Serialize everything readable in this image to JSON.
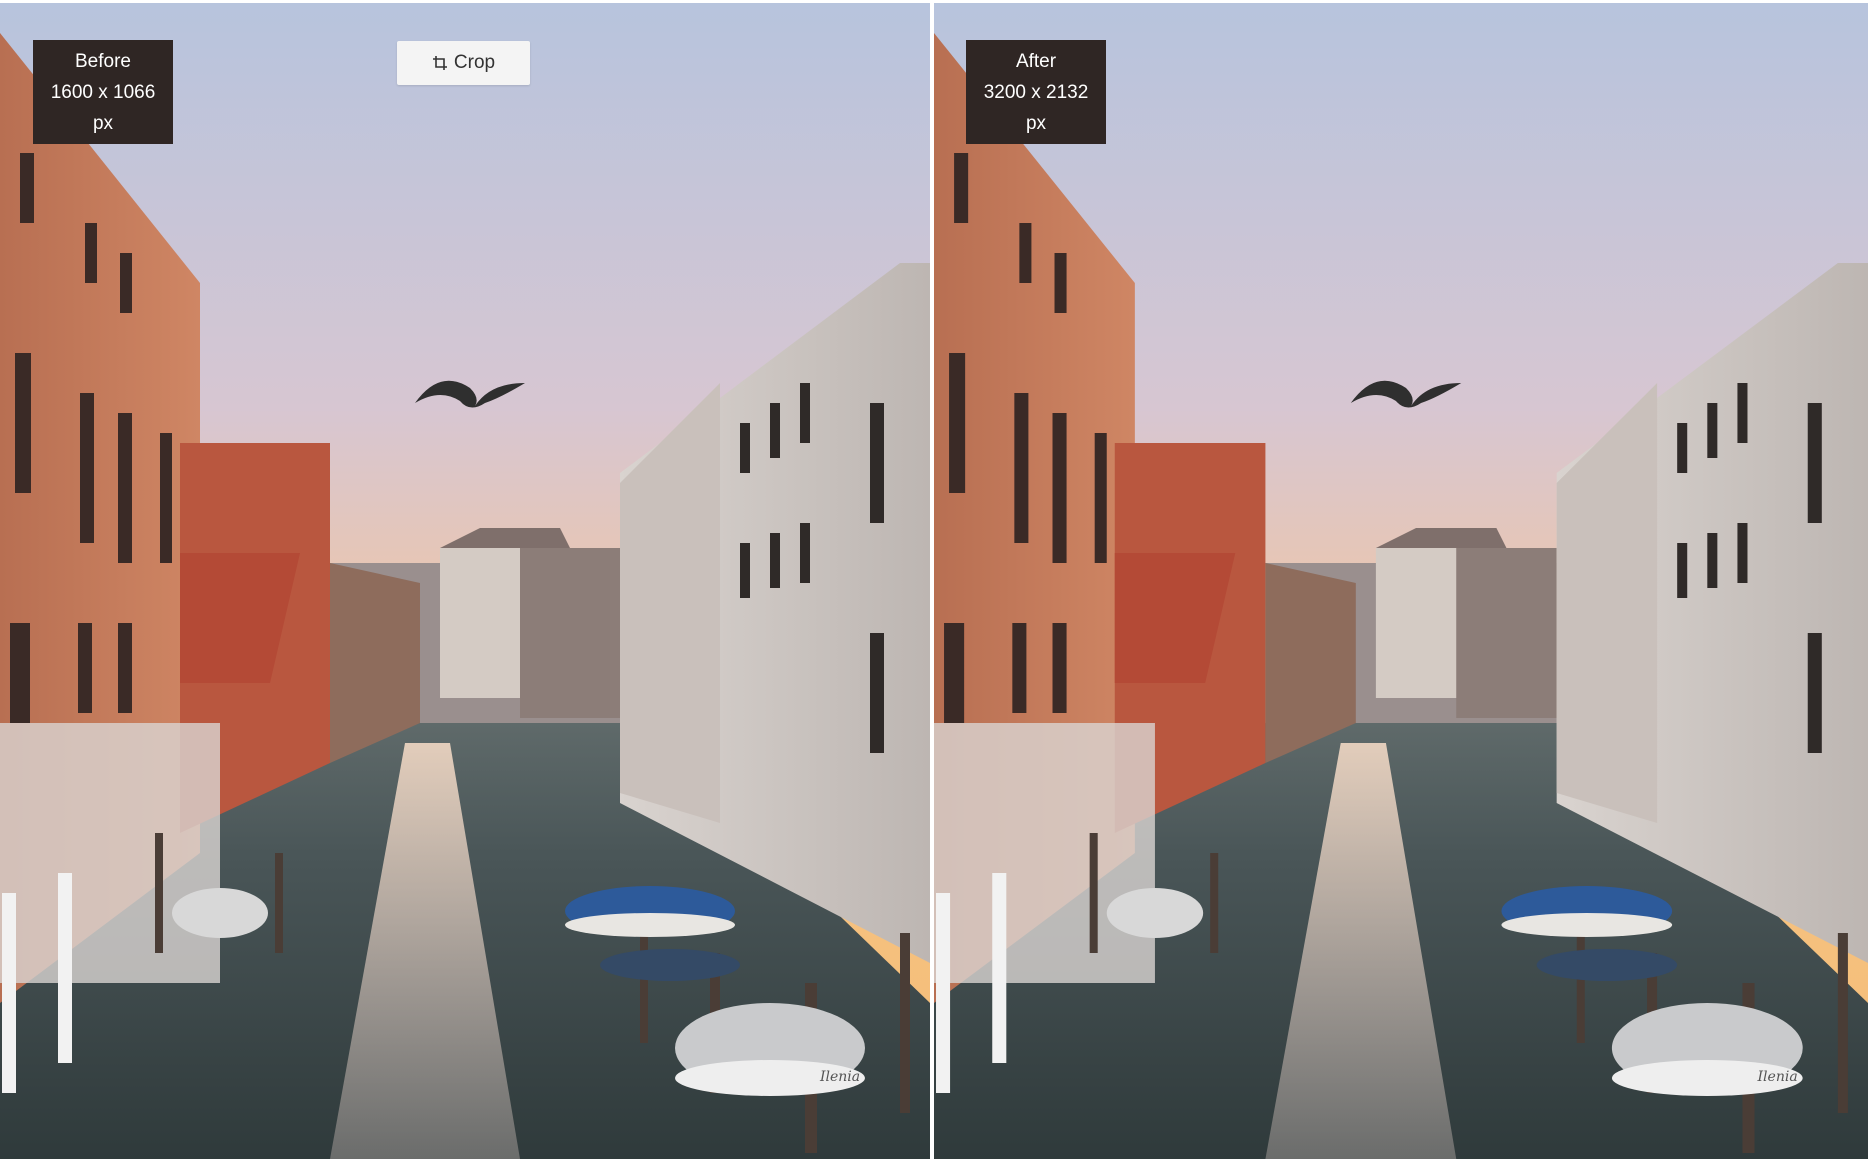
{
  "comparison": {
    "before": {
      "title": "Before",
      "dimensions": "1600 x 1066 px"
    },
    "after": {
      "title": "After",
      "dimensions": "3200 x 2132 px"
    }
  },
  "toolbar": {
    "crop_label": "Crop",
    "crop_icon": "crop-icon"
  },
  "photo": {
    "subject": "Venetian canal at sunset with boats and a gull",
    "boat_name": "Ilenia"
  },
  "colors": {
    "label_bg": "#2f2624",
    "label_text": "#ffffff",
    "button_bg": "#f4f4f4",
    "sky_top": "#b9c6de",
    "sky_bottom": "#f6c58a",
    "water": "#3d4a4c"
  }
}
